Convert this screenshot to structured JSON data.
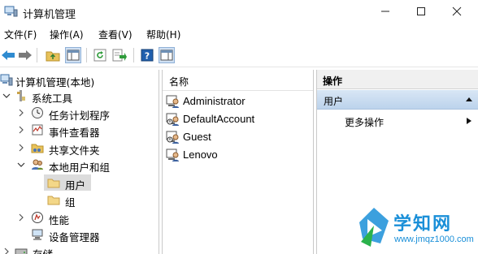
{
  "window": {
    "title": "计算机管理"
  },
  "menu": [
    "文件(F)",
    "操作(A)",
    "查看(V)",
    "帮助(H)"
  ],
  "tree": {
    "root": "计算机管理(本地)",
    "system_tools": "系统工具",
    "task_scheduler": "任务计划程序",
    "event_viewer": "事件查看器",
    "shared_folders": "共享文件夹",
    "local_users_groups": "本地用户和组",
    "users": "用户",
    "groups": "组",
    "performance": "性能",
    "device_manager": "设备管理器",
    "storage": "存储"
  },
  "list": {
    "column_name": "名称",
    "users": [
      "Administrator",
      "DefaultAccount",
      "Guest",
      "Lenovo"
    ]
  },
  "actions": {
    "header": "操作",
    "section": "用户",
    "more": "更多操作"
  },
  "watermark": {
    "brand": "学知网",
    "url": "www.jmqz1000.com"
  },
  "colors": {
    "accent": "#1a8fd8",
    "selection": "#dcdcdc",
    "section_band": "#c7daef"
  }
}
